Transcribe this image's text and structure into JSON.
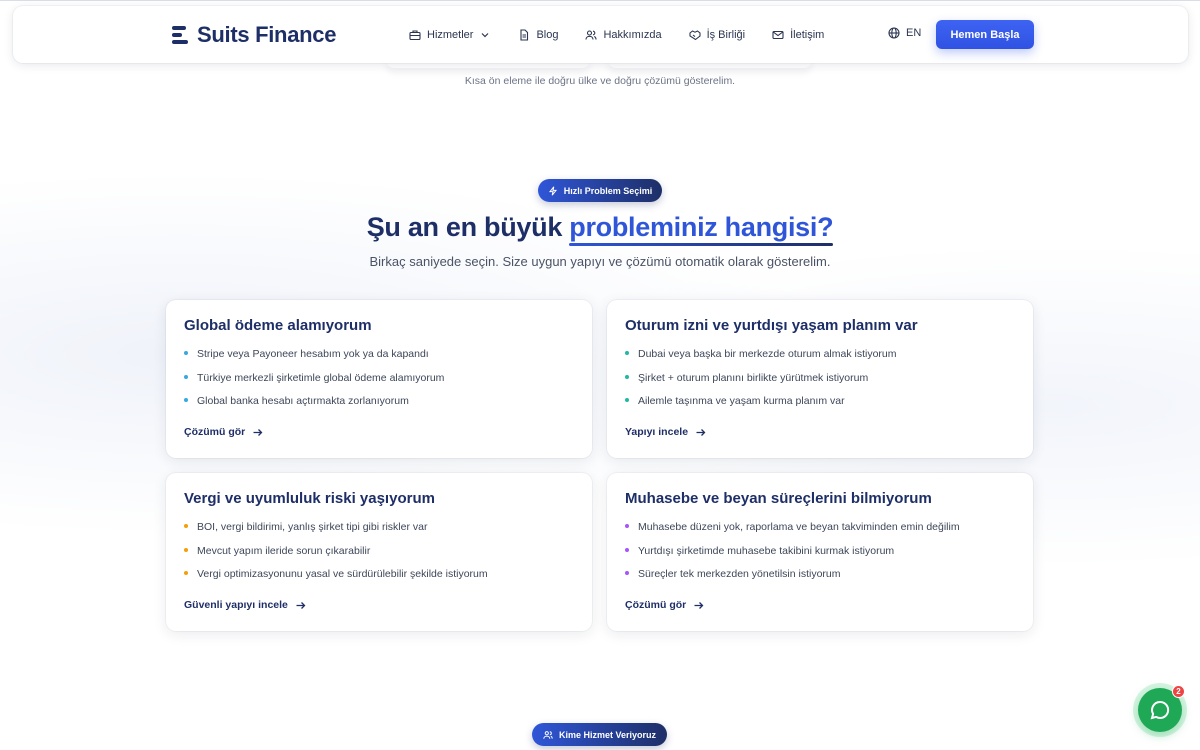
{
  "header": {
    "brand": "Suits Finance",
    "nav": [
      {
        "label": "Hizmetler",
        "icon": "briefcase-icon"
      },
      {
        "label": "Blog",
        "icon": "document-icon"
      },
      {
        "label": "Hakkımızda",
        "icon": "users-icon"
      },
      {
        "label": "İş Birliği",
        "icon": "handshake-icon"
      },
      {
        "label": "İletişim",
        "icon": "mail-icon"
      }
    ],
    "language": "EN",
    "cta_label": "Hemen Başla"
  },
  "previous_section": {
    "caption": "Kısa ön eleme ile doğru ülke ve doğru çözümü gösterelim."
  },
  "problem_section": {
    "badge": "Hızlı Problem Seçimi",
    "heading_pre": "Şu an en büyük ",
    "heading_highlight": "probleminiz hangisi?",
    "subheading": "Birkaç saniyede seçin. Size uygun yapıyı ve çözümü otomatik olarak gösterelim.",
    "cards": [
      {
        "title": "Global ödeme alamıyorum",
        "dot_color": "#38a9e0",
        "items": [
          "Stripe veya Payoneer hesabım yok ya da kapandı",
          "Türkiye merkezli şirketimle global ödeme alamıyorum",
          "Global banka hesabı açtırmakta zorlanıyorum"
        ],
        "link": "Çözümü gör"
      },
      {
        "title": "Oturum izni ve yurtdışı yaşam planım var",
        "dot_color": "#22b8a5",
        "items": [
          "Dubai veya başka bir merkezde oturum almak istiyorum",
          "Şirket + oturum planını birlikte yürütmek istiyorum",
          "Ailemle taşınma ve yaşam kurma planım var"
        ],
        "link": "Yapıyı incele"
      },
      {
        "title": "Vergi ve uyumluluk riski yaşıyorum",
        "dot_color": "#f59e0b",
        "items": [
          "BOI, vergi bildirimi, yanlış şirket tipi gibi riskler var",
          "Mevcut yapım ileride sorun çıkarabilir",
          "Vergi optimizasyonunu yasal ve sürdürülebilir şekilde istiyorum"
        ],
        "link": "Güvenli yapıyı incele"
      },
      {
        "title": "Muhasebe ve beyan süreçlerini bilmiyorum",
        "dot_color": "#a855f7",
        "items": [
          "Muhasebe düzeni yok, raporlama ve beyan takviminden emin değilim",
          "Yurtdışı şirketimde muhasebe takibini kurmak istiyorum",
          "Süreçler tek merkezden yönetilsin istiyorum"
        ],
        "link": "Çözümü gör"
      }
    ]
  },
  "next_section": {
    "badge": "Kime Hizmet Veriyoruz"
  },
  "chat": {
    "unread_count": "2",
    "icon": "chat-icon"
  }
}
